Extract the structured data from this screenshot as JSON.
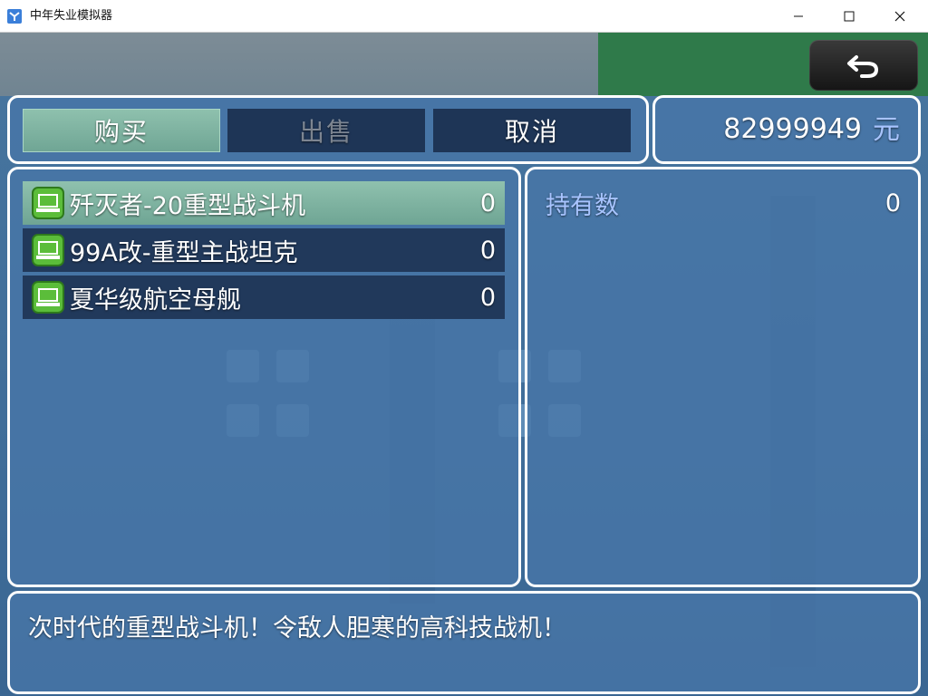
{
  "window": {
    "title": "中年失业模拟器",
    "icons": {
      "app": "app-icon",
      "minimize": "minimize-icon",
      "maximize": "maximize-icon",
      "close": "close-icon"
    }
  },
  "back_button": {
    "icon": "back-arrow-icon"
  },
  "commands": [
    {
      "label": "购买",
      "state": "selected"
    },
    {
      "label": "出售",
      "state": "disabled"
    },
    {
      "label": "取消",
      "state": "normal"
    }
  ],
  "gold": {
    "amount": "82999949",
    "unit": "元"
  },
  "items": [
    {
      "name": "歼灭者-20重型战斗机",
      "count": "0",
      "icon": "laptop-item-icon"
    },
    {
      "name": "99A改-重型主战坦克",
      "count": "0",
      "icon": "laptop-item-icon"
    },
    {
      "name": "夏华级航空母舰",
      "count": "0",
      "icon": "laptop-item-icon"
    }
  ],
  "status": {
    "label": "持有数",
    "value": "0"
  },
  "help": {
    "text": "次时代的重型战斗机！令敌人胆寒的高科技战机！"
  },
  "colors": {
    "panel_border": "#ffffff",
    "panel_fill": "#4876a8",
    "selected_fill": "#8fc1ae",
    "system_text": "#a8c4ff",
    "button_fill": "#182a48"
  }
}
